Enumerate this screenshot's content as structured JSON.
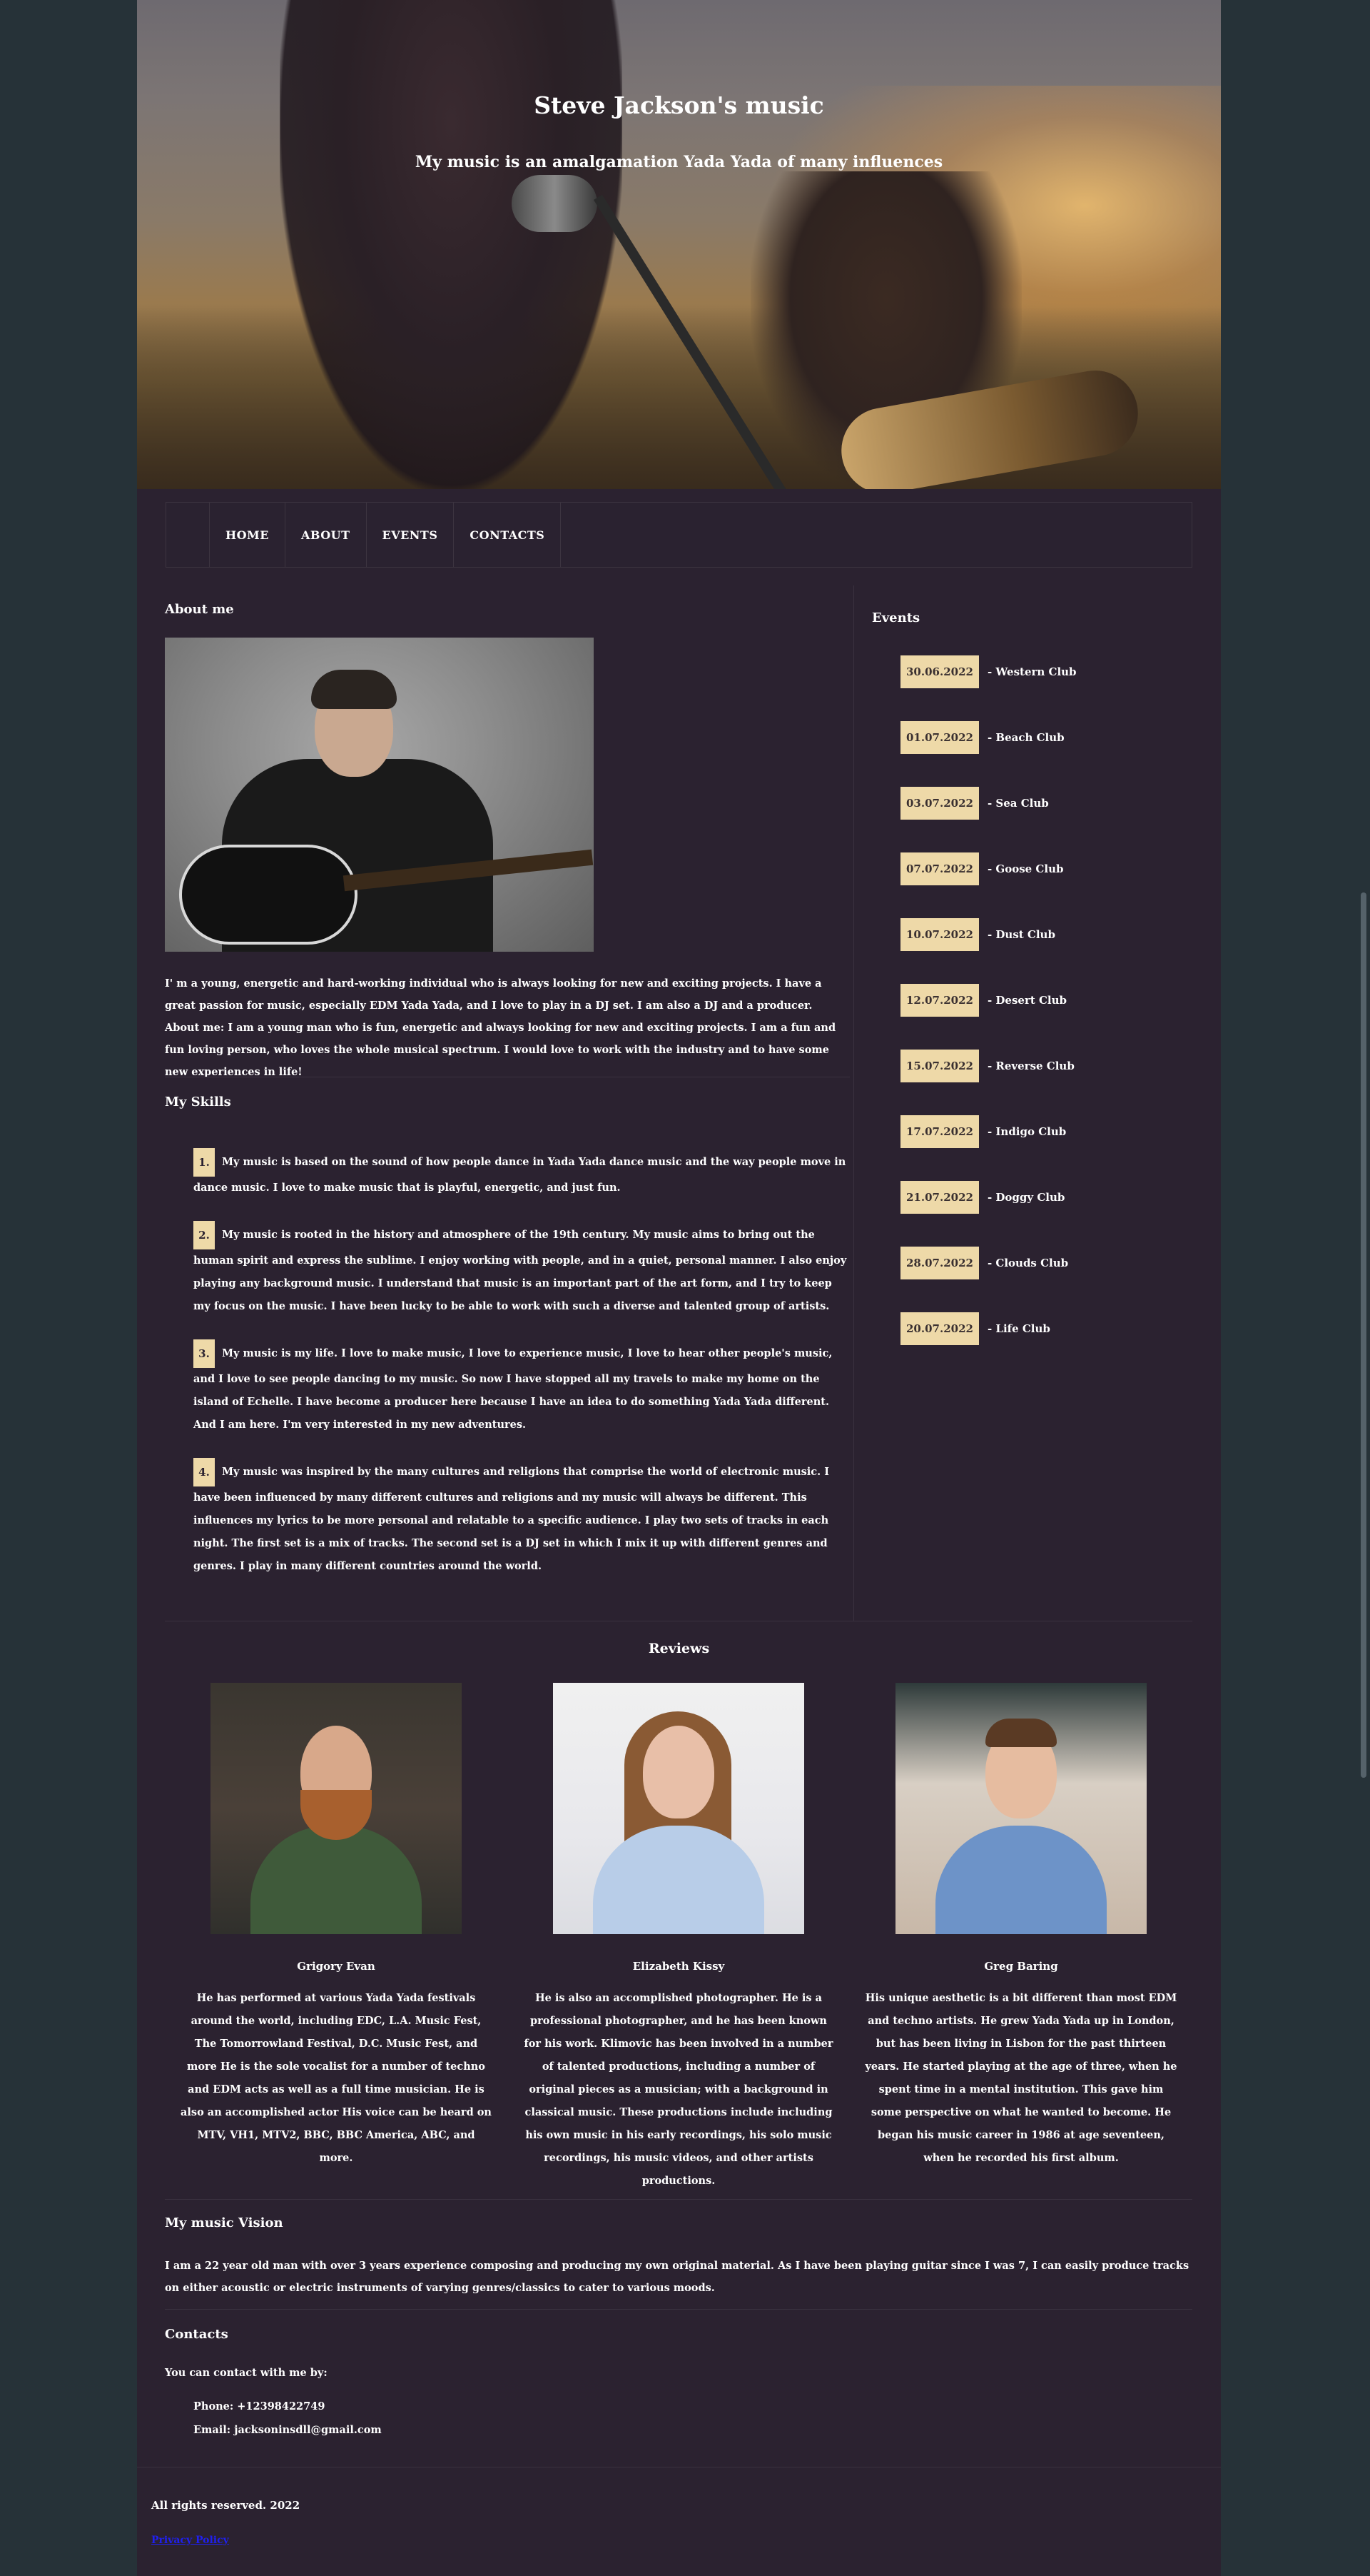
{
  "hero": {
    "title": "Steve Jackson's music",
    "subtitle": "My music is an amalgamation Yada Yada of many influences"
  },
  "nav": {
    "items": [
      "HOME",
      "ABOUT",
      "EVENTS",
      "CONTACTS"
    ]
  },
  "about": {
    "heading": "About me",
    "text": "I' m a young, energetic and hard-working individual who is always looking for new and exciting projects. I have a great passion for music, especially EDM Yada Yada, and I love to play in a DJ set. I am also a DJ and a producer. About me: I am a young man who is fun, energetic and always looking for new and exciting projects. I am a fun and fun loving person, who loves the whole musical spectrum. I would love to work with the industry and to have some new experiences in life!"
  },
  "skills": {
    "heading": "My Skills",
    "items": [
      {
        "num": "1.",
        "text": "My music is based on the sound of how people dance in Yada Yada dance music and the way people move in dance music. I love to make music that is playful, energetic, and just fun."
      },
      {
        "num": "2.",
        "text": "My music is rooted in the history and atmosphere of the 19th century. My music aims to bring out the human spirit and express the sublime. I enjoy working with people, and in a quiet, personal manner. I also enjoy playing any background music. I understand that music is an important part of the art form, and I try to keep my focus on the music. I have been lucky to be able to work with such a diverse and talented group of artists."
      },
      {
        "num": "3.",
        "text": "My music is my life. I love to make music, I love to experience music, I love to hear other people's music, and I love to see people dancing to my music. So now I have stopped all my travels to make my home on the island of Echelle. I have become a producer here because I have an idea to do something Yada Yada different. And I am here. I'm very interested in my new adventures."
      },
      {
        "num": "4.",
        "text": "My music was inspired by the many cultures and religions that comprise the world of electronic music. I have been influenced by many different cultures and religions and my music will always be different. This influences my lyrics to be more personal and relatable to a specific audience. I play two sets of tracks in each night. The first set is a mix of tracks. The second set is a DJ set in which I mix it up with different genres and genres. I play in many different countries around the world."
      }
    ]
  },
  "events": {
    "heading": "Events",
    "items": [
      {
        "date": "30.06.2022",
        "name": "- Western Club"
      },
      {
        "date": "01.07.2022",
        "name": "- Beach Club"
      },
      {
        "date": "03.07.2022",
        "name": "- Sea Club"
      },
      {
        "date": "07.07.2022",
        "name": "- Goose Club"
      },
      {
        "date": "10.07.2022",
        "name": "- Dust Club"
      },
      {
        "date": "12.07.2022",
        "name": "- Desert Club"
      },
      {
        "date": "15.07.2022",
        "name": "- Reverse Club"
      },
      {
        "date": "17.07.2022",
        "name": "- Indigo Club"
      },
      {
        "date": "21.07.2022",
        "name": "- Doggy Club"
      },
      {
        "date": "28.07.2022",
        "name": "- Clouds Club"
      },
      {
        "date": "20.07.2022",
        "name": "- Life Club"
      }
    ]
  },
  "reviews": {
    "heading": "Reviews",
    "items": [
      {
        "name": "Grigory Evan",
        "text": "He has performed at various Yada Yada festivals around the world, including EDC, L.A. Music Fest, The Tomorrowland Festival, D.C. Music Fest, and more He is the sole vocalist for a number of techno and EDM acts as well as a full time musician. He is also an accomplished actor His voice can be heard on MTV, VH1, MTV2, BBC, BBC America, ABC, and more."
      },
      {
        "name": "Elizabeth Kissy",
        "text": "He is also an accomplished photographer. He is a professional photographer, and he has been known for his work. Klimovic has been involved in a number of talented productions, including a number of original pieces as a musician; with a background in classical music. These productions include including his own music in his early recordings, his solo music recordings, his music videos, and other artists productions."
      },
      {
        "name": "Greg Baring",
        "text": "His unique aesthetic is a bit different than most EDM and techno artists. He grew Yada Yada up in London, but has been living in Lisbon for the past thirteen years. He started playing at the age of three, when he spent time in a mental institution. This gave him some perspective on what he wanted to become. He began his music career in 1986 at age seventeen, when he recorded his first album."
      }
    ]
  },
  "vision": {
    "heading": "My music Vision",
    "text": "I am a 22 year old man with over 3 years experience composing and producing my own original material. As I have been playing guitar since I was 7, I can easily produce tracks on either acoustic or electric instruments of varying genres/classics to cater to various moods."
  },
  "contacts": {
    "heading": "Contacts",
    "intro": "You can contact with me by:",
    "phone": "Phone: +12398422749",
    "email": "Email: jacksoninsdll@gmail.com"
  },
  "footer": {
    "rights": "All rights reserved. 2022",
    "link": "Privacy Policy"
  },
  "colors": {
    "background": "#263238",
    "page": "#2b2230",
    "accent": "#eed9a8"
  }
}
